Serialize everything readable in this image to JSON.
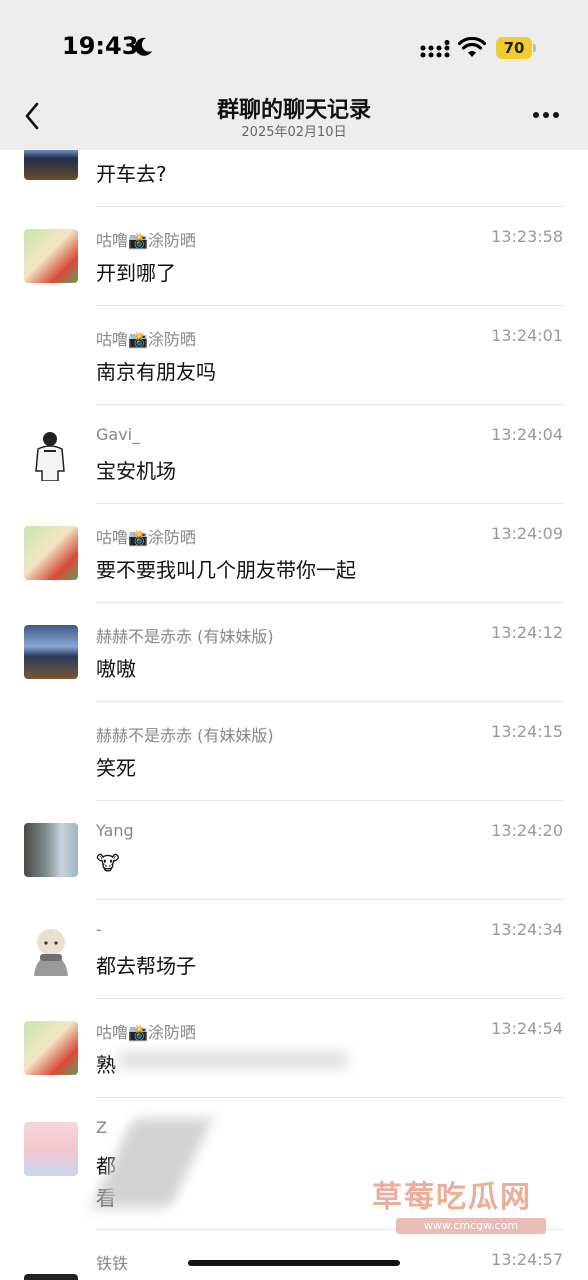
{
  "status_bar": {
    "time": "19:43",
    "battery": "70"
  },
  "nav": {
    "title": "群聊的聊天记录",
    "subtitle": "2025年02月10日"
  },
  "messages": [
    {
      "sender": "",
      "time": "",
      "text": "开车去?"
    },
    {
      "sender": "咕噜📸涂防晒",
      "time": "13:23:58",
      "text": "开到哪了"
    },
    {
      "sender": "咕噜📸涂防晒",
      "time": "13:24:01",
      "text": "南京有朋友吗"
    },
    {
      "sender": "Gavi_",
      "time": "13:24:04",
      "text": "宝安机场"
    },
    {
      "sender": "咕噜📸涂防晒",
      "time": "13:24:09",
      "text": "要不要我叫几个朋友带你一起"
    },
    {
      "sender": "赫赫不是赤赤 (有妹妹版)",
      "time": "13:24:12",
      "text": "嗷嗷"
    },
    {
      "sender": "赫赫不是赤赤 (有妹妹版)",
      "time": "13:24:15",
      "text": "笑死"
    },
    {
      "sender": "Yang",
      "time": "13:24:20",
      "text": "🐮"
    },
    {
      "sender": "-",
      "time": "13:24:34",
      "text": "都去帮场子"
    },
    {
      "sender": "咕噜📸涂防晒",
      "time": "13:24:54",
      "text": "熟"
    },
    {
      "sender": "Z",
      "time": "",
      "text": "都",
      "text2": "看"
    },
    {
      "sender": "铁铁",
      "time": "13:24:57",
      "text": ""
    }
  ],
  "watermark": {
    "text": "草莓吃瓜网",
    "url": "www.cmcgw.com"
  }
}
